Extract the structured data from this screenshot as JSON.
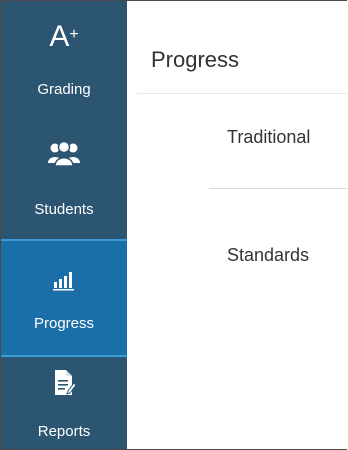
{
  "sidebar": {
    "items": [
      {
        "label": "Grading",
        "icon": "grading-a-plus-icon",
        "icon_text": "A",
        "icon_sup": "+"
      },
      {
        "label": "Students",
        "icon": "students-group-icon"
      },
      {
        "label": "Progress",
        "icon": "progress-bar-chart-icon",
        "active": true
      },
      {
        "label": "Reports",
        "icon": "report-document-icon"
      }
    ],
    "background": "#2b5570",
    "active_background": "#1b6fa8"
  },
  "main": {
    "title": "Progress",
    "tabs": [
      {
        "label": "Traditional"
      },
      {
        "label": "Standards"
      }
    ]
  }
}
